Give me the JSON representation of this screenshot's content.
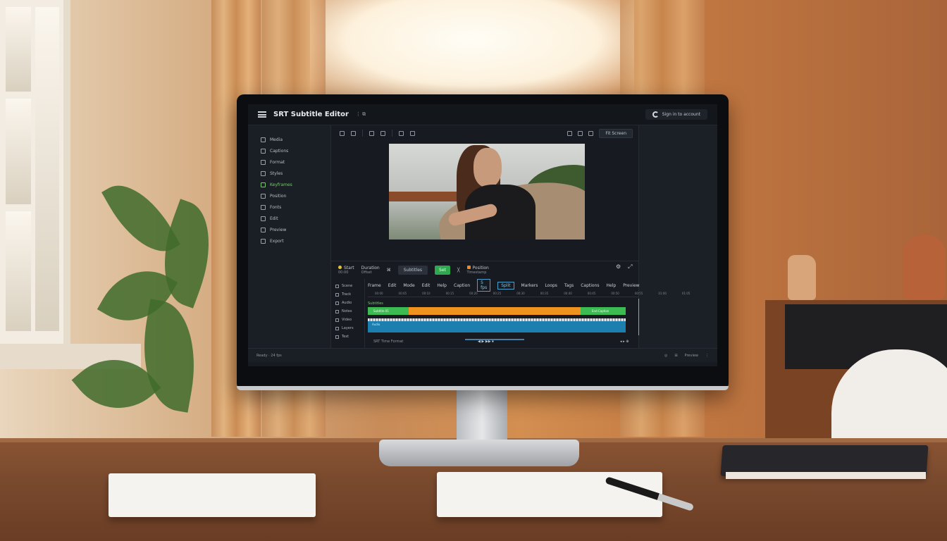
{
  "app": {
    "title": "SRT Subtitle Editor",
    "title_icons": "⋮ ⧉",
    "account_label": "Sign in to account"
  },
  "sidebar": {
    "items": [
      {
        "label": "Media",
        "icon": "media-icon"
      },
      {
        "label": "Captions",
        "icon": "captions-icon"
      },
      {
        "label": "Format",
        "icon": "format-icon"
      },
      {
        "label": "Styles",
        "icon": "styles-icon"
      },
      {
        "label": "Keyframes",
        "icon": "keyframes-icon",
        "active": true
      },
      {
        "label": "Position",
        "icon": "position-icon"
      },
      {
        "label": "Fonts",
        "icon": "fonts-icon"
      },
      {
        "label": "Edit",
        "icon": "edit-icon"
      },
      {
        "label": "Preview",
        "icon": "preview-icon"
      },
      {
        "label": "Export",
        "icon": "export-icon"
      }
    ]
  },
  "toolbar": {
    "zoom_label": "Fit Screen"
  },
  "transport": {
    "start_label": "Start",
    "start_sub": "00:00",
    "duration_label": "Duration",
    "duration_sub": "Offset",
    "sync_label": "Subtitles",
    "set_label": "Set",
    "position_label": "Position",
    "position_sub": "Timestamp"
  },
  "timeline": {
    "side_items": [
      "Scene",
      "Track",
      "Audio",
      "Notes",
      "Video",
      "Layers",
      "Text"
    ],
    "menu": [
      "Frame",
      "Edit",
      "Mode",
      "Edit",
      "Help",
      "Caption"
    ],
    "menu_selected": [
      "5 fps",
      "Split"
    ],
    "menu_after": [
      "Markers",
      "Loops",
      "Tags",
      "Captions",
      "Help",
      "Preview"
    ],
    "ruler_ticks": [
      "00:00",
      "00:05",
      "00:10",
      "00:15",
      "00:20",
      "00:25",
      "00:30",
      "00:35",
      "00:40",
      "00:45",
      "00:50",
      "00:55",
      "01:00",
      "01:05"
    ],
    "track_title": "Subtitles",
    "caption_start_label": "Subtitle 01",
    "caption_end_label": "End Caption",
    "blue_label": "Audio",
    "bottom_label": "SRT Time Format",
    "controls": "◀ ▶ ▶▶ ⏹",
    "right_ctrl": "◂ ▸ ⊕"
  },
  "status": {
    "left": "Ready · 24 fps",
    "right": [
      "◎",
      "⊞",
      "Preview"
    ],
    "far_right": "⋮"
  },
  "colors": {
    "accent_green": "#3dbb53",
    "accent_orange": "#f0921e",
    "accent_blue": "#1d7fb0",
    "screen_bg": "#171b21"
  }
}
